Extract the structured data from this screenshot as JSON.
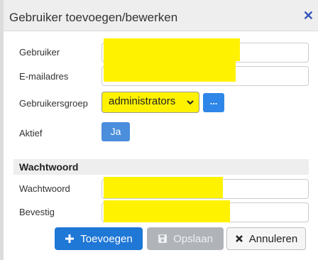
{
  "dialog": {
    "title": "Gebruiker toevoegen/bewerken",
    "close_icon": "close-icon"
  },
  "form": {
    "user_label": "Gebruiker",
    "user_value": "",
    "email_label": "E-mailadres",
    "email_value": "",
    "group_label": "Gebruikersgroep",
    "group_value": "administrators",
    "group_more_label": "...",
    "active_label": "Aktief",
    "active_value": "Ja"
  },
  "password_section": {
    "heading": "Wachtwoord",
    "password_label": "Wachtwoord",
    "password_value": "",
    "confirm_label": "Bevestig",
    "confirm_value": ""
  },
  "buttons": {
    "add_label": "Toevoegen",
    "save_label": "Opslaan",
    "cancel_label": "Annuleren"
  },
  "colors": {
    "primary": "#1f77d6",
    "highlight": "#fff200",
    "disabled": "#b0b3b8"
  }
}
